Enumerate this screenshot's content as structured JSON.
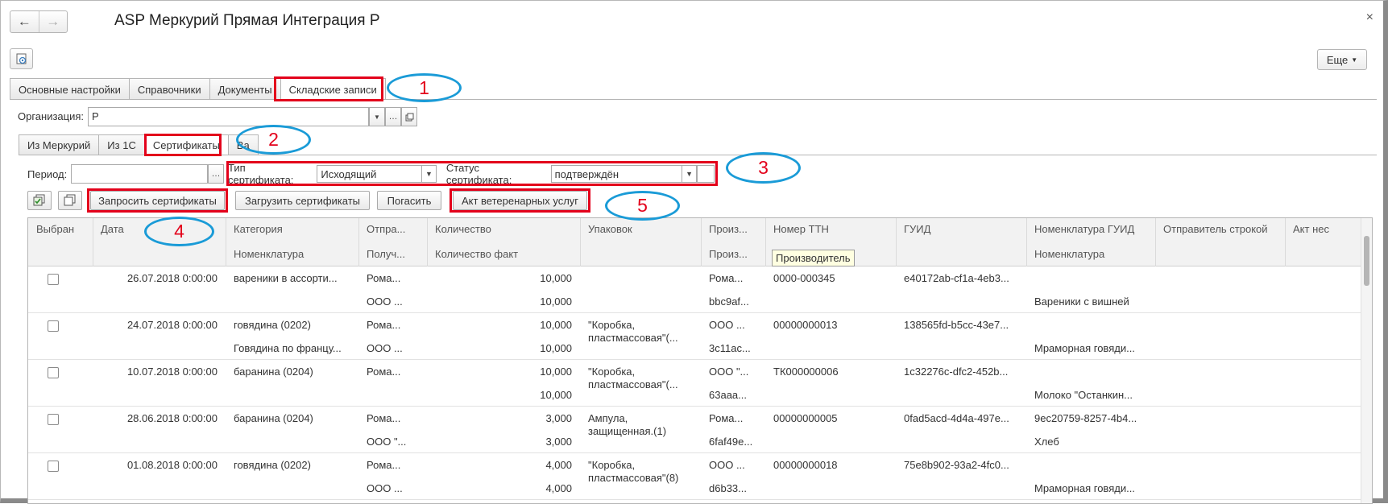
{
  "window": {
    "title": "ASP Меркурий Прямая Интеграция Р",
    "more_label": "Еще",
    "close_glyph": "×"
  },
  "nav": {
    "back_glyph": "←",
    "forward_glyph": "→"
  },
  "main_tabs": [
    {
      "label": "Основные настройки"
    },
    {
      "label": "Справочники"
    },
    {
      "label": "Документы"
    },
    {
      "label": "Складские записи"
    }
  ],
  "organization": {
    "label": "Организация:",
    "value": "Р"
  },
  "sub_tabs": [
    {
      "label": "Из Меркурий"
    },
    {
      "label": "Из 1С"
    },
    {
      "label": "Сертификаты"
    },
    {
      "label": "Ва"
    }
  ],
  "filters": {
    "period_label": "Период:",
    "period_value": "",
    "cert_type_label": "Тип сертификата:",
    "cert_type_value": "Исходящий",
    "cert_status_label": "Статус сертификата:",
    "cert_status_value": "подтверждён"
  },
  "toolbar": {
    "request_label": "Запросить сертификаты",
    "load_label": "Загрузить сертификаты",
    "redeem_label": "Погасить",
    "vet_act_label": "Акт ветеренарных услуг"
  },
  "callouts": [
    "1",
    "2",
    "3",
    "4",
    "5"
  ],
  "table": {
    "headers_top": [
      "Выбран",
      "Дата",
      "Категория",
      "Отпра...",
      "Количество",
      "Упаковок",
      "Произ...",
      "Номер ТТН",
      "ГУИД",
      "Номенклатура ГУИД",
      "Отправитель строкой",
      "Акт нес"
    ],
    "headers_bottom": [
      "Номенклатура",
      "Получ...",
      "Количество факт",
      "Произ...",
      "Номенклатура"
    ],
    "tooltip": "Производитель",
    "rows": [
      {
        "date": "26.07.2018 0:00:00",
        "category": "вареники в ассорти...",
        "sender": "Рома...",
        "qty": "10,000",
        "pack": "",
        "prod": "Рома...",
        "ttn": "0000-000345",
        "guid": "e40172ab-cf1a-4eb3...",
        "nom_guid": "",
        "nomen": "",
        "recv": "ООО ...",
        "qty_fact": "10,000",
        "pack2": "",
        "prod2": "bbc9af...",
        "nomen2": "Вареники с вишней"
      },
      {
        "date": "24.07.2018 0:00:00",
        "category": "говядина (0202)",
        "sender": "Рома...",
        "qty": "10,000",
        "pack": "\"Коробка,",
        "prod": "ООО ...",
        "ttn": "00000000013",
        "guid": "138565fd-b5cc-43e7...",
        "nom_guid": "",
        "nomen": "Говядина по францу...",
        "recv": "ООО ...",
        "qty_fact": "10,000",
        "pack2": "пластмассовая\"(...",
        "prod2": "3c11ac...",
        "nomen2": "Мраморная говяди..."
      },
      {
        "date": "10.07.2018 0:00:00",
        "category": "баранина (0204)",
        "sender": "Рома...",
        "qty": "10,000",
        "pack": "\"Коробка,",
        "prod": "ООО \"...",
        "ttn": "ТК000000006",
        "guid": "1c32276c-dfc2-452b...",
        "nom_guid": "",
        "nomen": "",
        "recv": "",
        "qty_fact": "10,000",
        "pack2": "пластмассовая\"(...",
        "prod2": "63aaa...",
        "nomen2": "Молоко \"Останкин..."
      },
      {
        "date": "28.06.2018 0:00:00",
        "category": "баранина (0204)",
        "sender": "Рома...",
        "qty": "3,000",
        "pack": "Ампула,",
        "prod": "Рома...",
        "ttn": "00000000005",
        "guid": "0fad5acd-4d4a-497e...",
        "nom_guid": "9ec20759-8257-4b4...",
        "nomen": "",
        "recv": "ООО \"...",
        "qty_fact": "3,000",
        "pack2": "защищенная.(1)",
        "prod2": "6faf49e...",
        "nomen2": "Хлеб"
      },
      {
        "date": "01.08.2018 0:00:00",
        "category": "говядина (0202)",
        "sender": "Рома...",
        "qty": "4,000",
        "pack": "\"Коробка,",
        "prod": "ООО ...",
        "ttn": "00000000018",
        "guid": "75e8b902-93a2-4fc0...",
        "nom_guid": "",
        "nomen": "",
        "recv": "ООО ...",
        "qty_fact": "4,000",
        "pack2": "пластмассовая\"(8)",
        "prod2": "d6b33...",
        "nomen2": "Мраморная говяди..."
      }
    ]
  },
  "colors": {
    "highlight": "#e3001b",
    "callout_ring": "#1a9bd7",
    "tooltip_bg": "#ffffe1"
  }
}
